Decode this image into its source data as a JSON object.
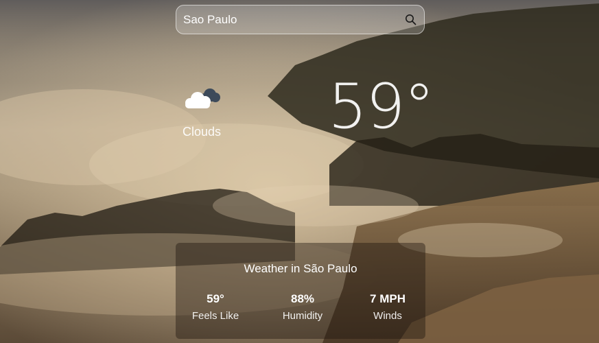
{
  "search": {
    "value": "Sao Paulo",
    "icon": "search-icon"
  },
  "current": {
    "icon": "clouds-icon",
    "condition": "Clouds",
    "temperature": "59°"
  },
  "details": {
    "title": "Weather in São Paulo",
    "stats": [
      {
        "value": "59°",
        "label": "Feels Like"
      },
      {
        "value": "88%",
        "label": "Humidity"
      },
      {
        "value": "7 MPH",
        "label": "Winds"
      }
    ]
  },
  "colors": {
    "text": "#ffffff",
    "card_background": "rgba(30,22,14,0.42)"
  }
}
